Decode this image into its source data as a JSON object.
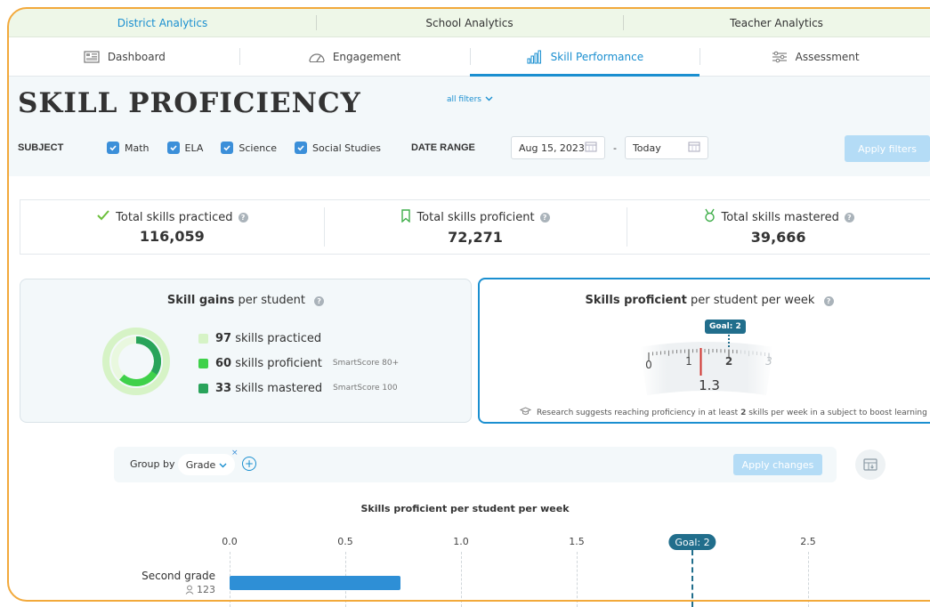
{
  "top_tabs": [
    {
      "label": "District Analytics"
    },
    {
      "label": "School Analytics"
    },
    {
      "label": "Teacher Analytics"
    }
  ],
  "sub_tabs": [
    {
      "label": "Dashboard",
      "icon": "dashboard-icon"
    },
    {
      "label": "Engagement",
      "icon": "speedometer-icon"
    },
    {
      "label": "Skill Performance",
      "icon": "bar-chart-icon"
    },
    {
      "label": "Assessment",
      "icon": "sliders-icon"
    }
  ],
  "page": {
    "title": "SKILL PROFICIENCY"
  },
  "filters": {
    "subject_label": "SUBJECT",
    "subjects": [
      "Math",
      "ELA",
      "Science",
      "Social Studies"
    ],
    "date_range_label": "DATE RANGE",
    "date_from": "Aug 15, 2023",
    "date_separator": "-",
    "date_to": "Today",
    "apply_label": "Apply filters",
    "all_filters_label": "all filters"
  },
  "stats": [
    {
      "label": "Total skills practiced",
      "value": "116,059",
      "icon": "checkmark-icon"
    },
    {
      "label": "Total skills proficient",
      "value": "72,271",
      "icon": "bookmark-icon"
    },
    {
      "label": "Total skills mastered",
      "value": "39,666",
      "icon": "medal-icon"
    }
  ],
  "skill_gains": {
    "title_bold": "Skill gains",
    "title_rest": " per student",
    "items": [
      {
        "value": "97",
        "label": "skills practiced",
        "note": ""
      },
      {
        "value": "60",
        "label": "skills proficient",
        "note": "SmartScore 80+"
      },
      {
        "value": "33",
        "label": "skills mastered",
        "note": "SmartScore 100"
      }
    ],
    "colors": {
      "practiced": "#d6f3c6",
      "proficient": "#3fd14a",
      "mastered": "#29a35a"
    }
  },
  "weekly": {
    "title_bold": "Skills proficient",
    "title_rest": " per student per week",
    "goal_label": "Goal: 2",
    "gauge_ticks": [
      "0",
      "1",
      "2",
      "3"
    ],
    "value": "1.3",
    "value_num": 1.3,
    "goal_num": 2,
    "research_pre": "Research suggests reaching proficiency in at least ",
    "research_bold": "2",
    "research_post": " skills per week in a subject to boost learning"
  },
  "group_by": {
    "label": "Group by",
    "value": "Grade",
    "apply_label": "Apply changes"
  },
  "chart_data": {
    "type": "bar",
    "title": "Skills proficient per student per week",
    "ticks": [
      "0.0",
      "0.5",
      "1.0",
      "1.5",
      "2.5"
    ],
    "goal_label": "Goal: 2",
    "goal": 2,
    "xlim": [
      0,
      3
    ],
    "categories": [
      "Second grade"
    ],
    "counts": [
      "123"
    ],
    "values": [
      0.74
    ],
    "color": "#2e8fd6"
  }
}
